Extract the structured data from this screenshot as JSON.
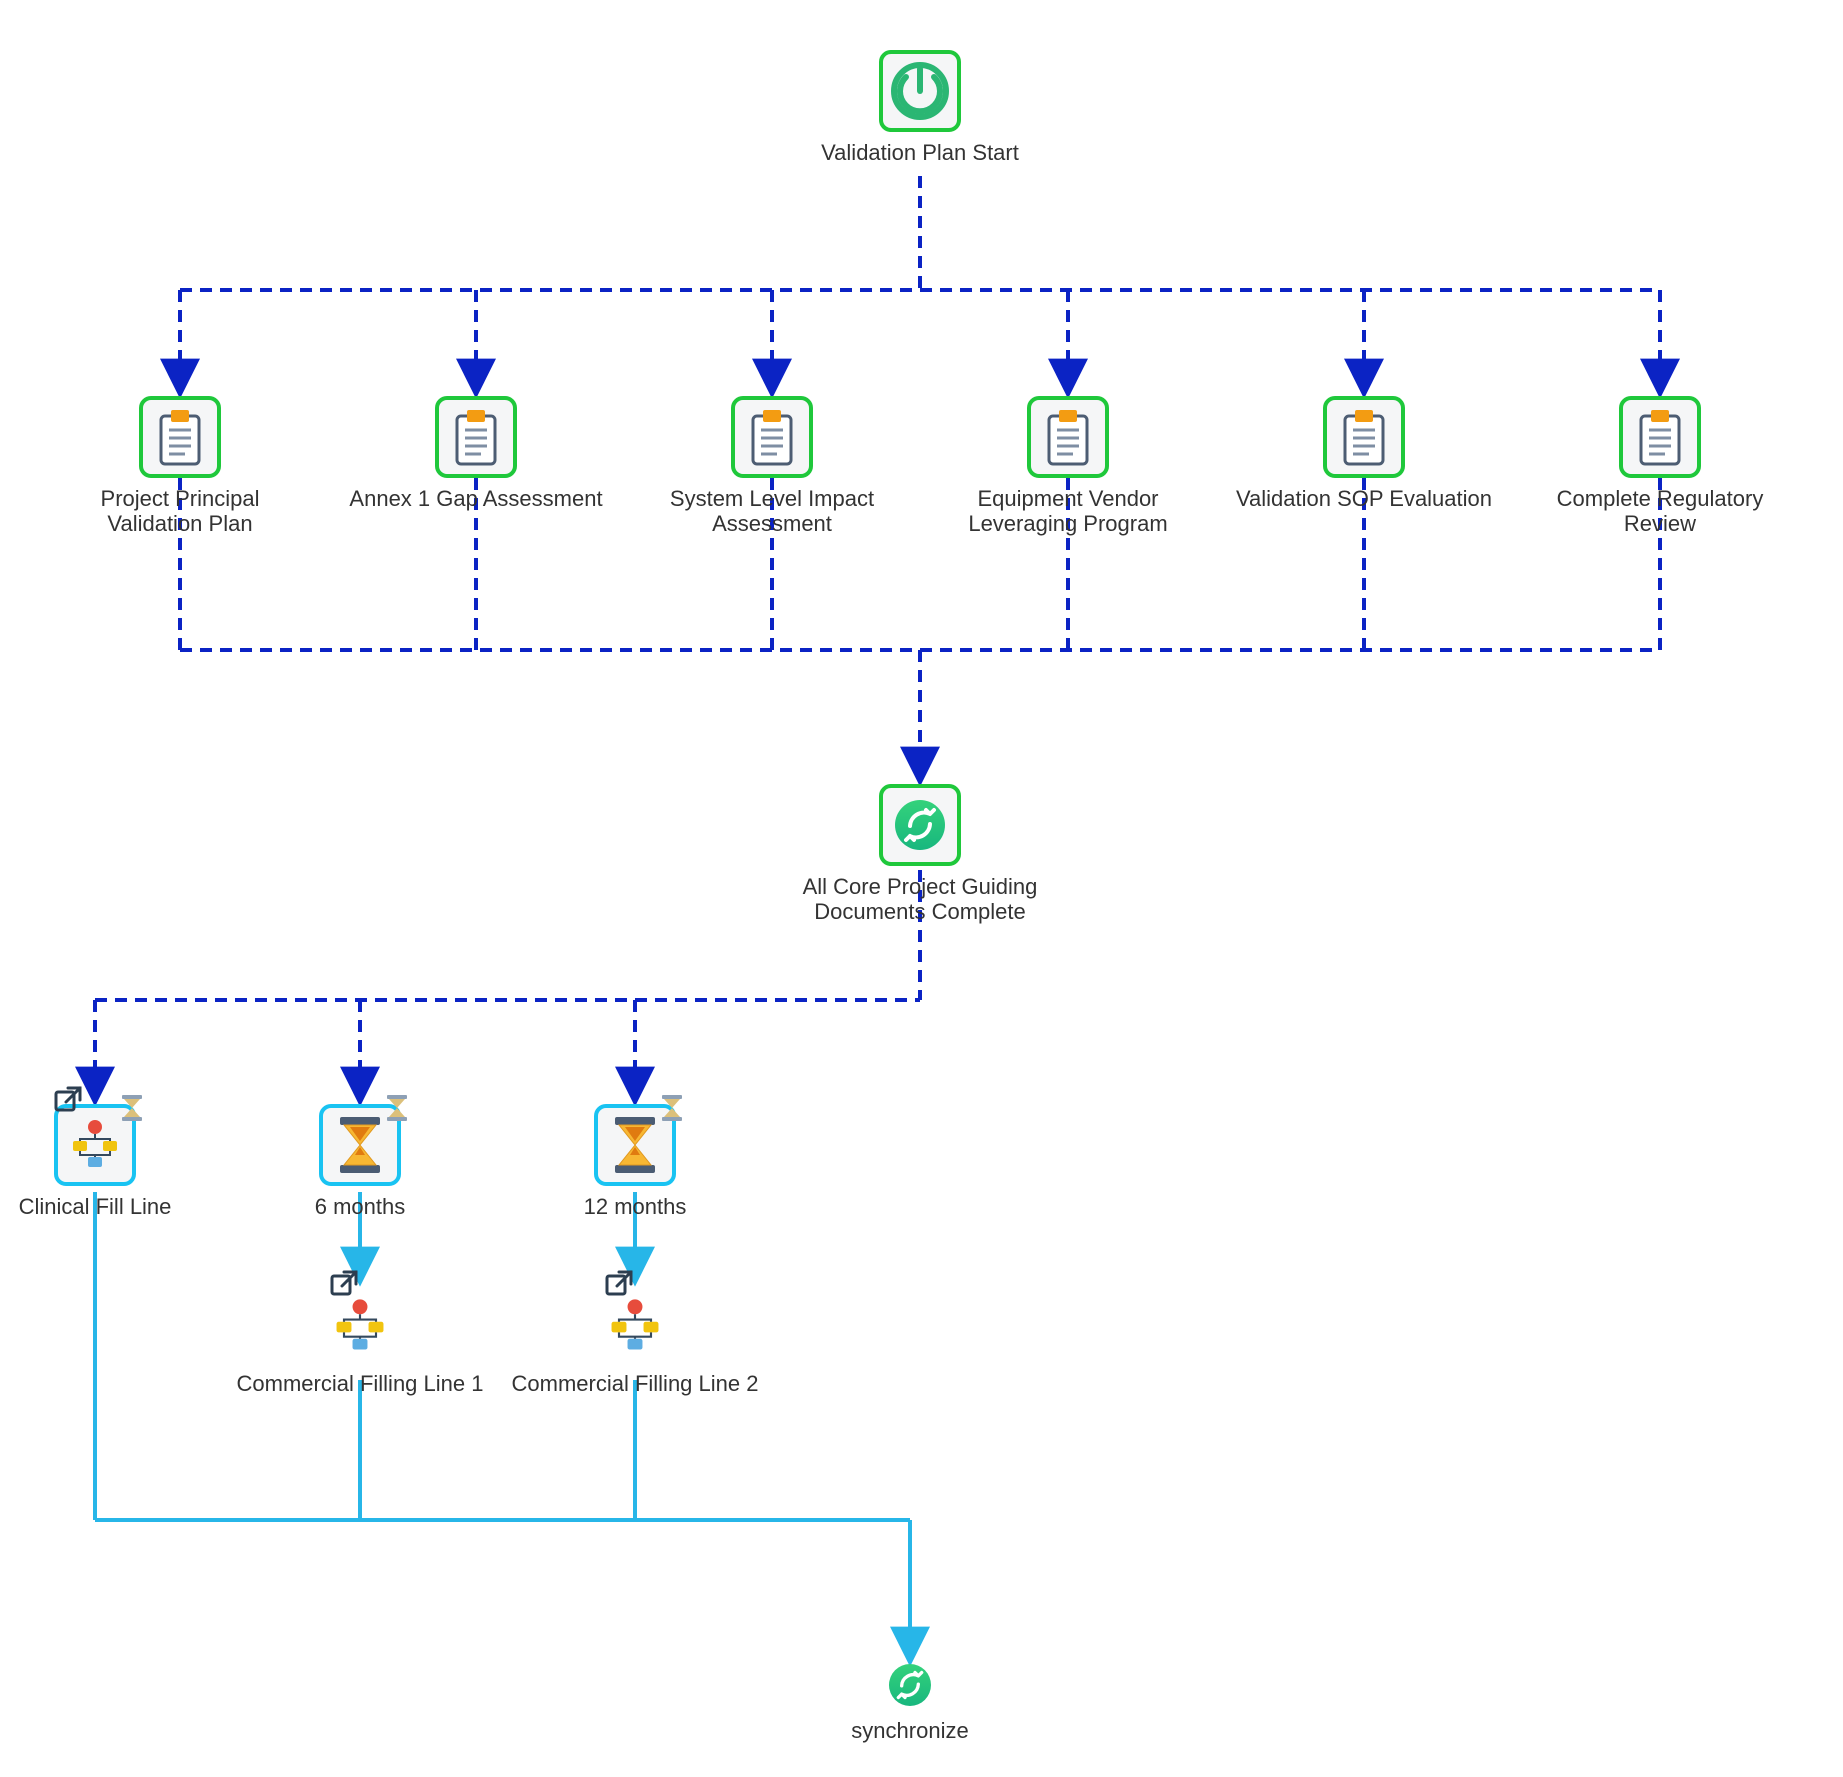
{
  "diagram": {
    "start": {
      "label": "Validation Plan Start"
    },
    "tasks": {
      "ppvp": {
        "label": "Project Principal Validation Plan"
      },
      "annex": {
        "label": "Annex 1 Gap Assessment"
      },
      "slia": {
        "label": "System Level Impact Assessment"
      },
      "evlp": {
        "label": "Equipment Vendor Leveraging Program"
      },
      "sop": {
        "label": "Validation SOP Evaluation"
      },
      "reg": {
        "label": "Complete Regulatory Review"
      }
    },
    "milestone": {
      "label": "All Core Project Guiding Documents Complete"
    },
    "branches": {
      "clinical": {
        "label": "Clinical Fill Line"
      },
      "wait6": {
        "label": "6 months"
      },
      "wait12": {
        "label": "12 months"
      },
      "cfl1": {
        "label": "Commercial Filling Line 1"
      },
      "cfl2": {
        "label": "Commercial Filling Line 2"
      }
    },
    "sync": {
      "label": "synchronize"
    }
  },
  "colors": {
    "green": "#1fc83b",
    "cyan": "#19c3f2",
    "navy": "#0b23c4",
    "lightblue": "#27b6e8"
  }
}
